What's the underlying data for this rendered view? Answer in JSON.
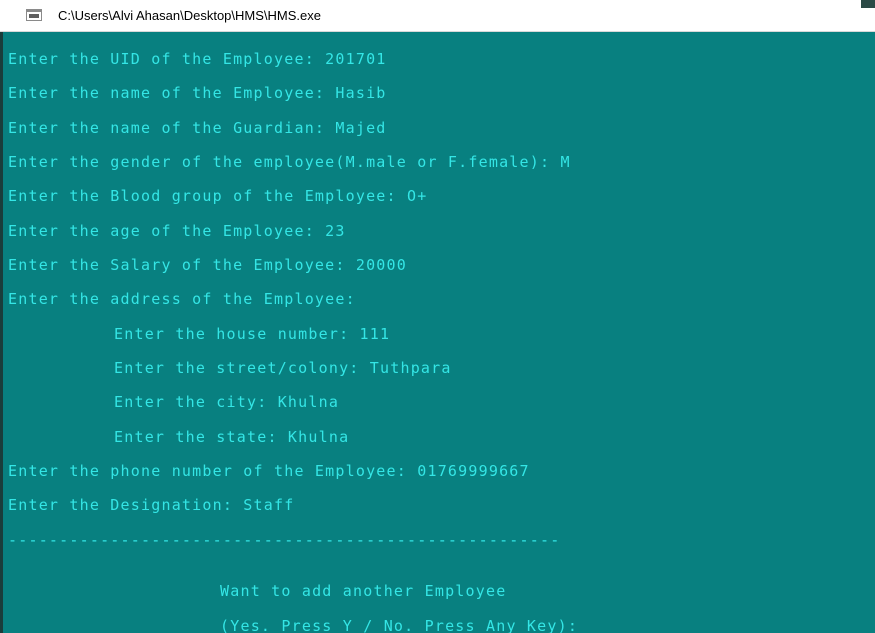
{
  "window": {
    "title": "C:\\Users\\Alvi Ahasan\\Desktop\\HMS\\HMS.exe",
    "icon": "console-window-icon",
    "background_color": "#088080",
    "text_color": "#34e6e6"
  },
  "console": {
    "lines": [
      "Enter the UID of the Employee: 201701",
      "Enter the name of the Employee: Hasib",
      "Enter the name of the Guardian: Majed",
      "Enter the gender of the employee(M.male or F.female): M",
      "Enter the Blood group of the Employee: O+",
      "Enter the age of the Employee: 23",
      "Enter the Salary of the Employee: 20000",
      "Enter the address of the Employee:",
      "Enter the house number: 111",
      "Enter the street/colony: Tuthpara",
      "Enter the city: Khulna",
      "Enter the state: Khulna",
      "Enter the phone number of the Employee: 01769999667",
      "Enter the Designation: Staff",
      "------------------------------------------------------",
      "Want to add another Employee",
      "(Yes. Press Y / No. Press Any Key):"
    ]
  }
}
